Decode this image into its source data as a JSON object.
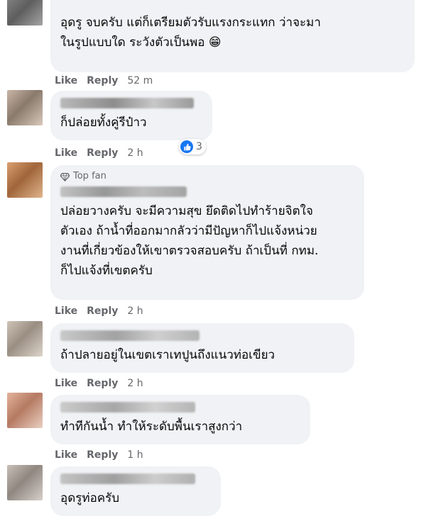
{
  "comments": [
    {
      "text": "อุดรู จบครับ แต่ก็เตรียมตัวรับแรงกระแทก ว่าจะมา\nในรูปแบบใด ระวังตัวเป็นพอ 😁",
      "actions": {
        "like": "Like",
        "reply": "Reply",
        "time": "52 m"
      }
    },
    {
      "text": "ก็ปล่อยทั้งคู่รีป๋าว",
      "actions": {
        "like": "Like",
        "reply": "Reply",
        "time": "2 h"
      },
      "reaction_count": "3"
    },
    {
      "badge": "Top fan",
      "text": "ปล่อยวางครับ จะมีความสุข ยึดติดไปทำร้ายจิตใจ\nตัวเอง ถ้าน้ำที่ออกมากลัวว่ามีปัญหาก็ไปแจ้งหน่วย\nงานที่เกี่ยวข้องให้เขาตรวจสอบครับ ถ้าเป็นที่ กทม.\nก็ไปแจ้งที่เขตครับ",
      "actions": {
        "like": "Like",
        "reply": "Reply",
        "time": "2 h"
      }
    },
    {
      "text": "ถ้าปลายอยู่ในเขตเราเทปูนถึงแนวท่อเขียว",
      "actions": {
        "like": "Like",
        "reply": "Reply",
        "time": "2 h"
      }
    },
    {
      "text": "ทำทีกันน้ำ ทำให้ระดับพื้นเราสูงกว่า",
      "actions": {
        "like": "Like",
        "reply": "Reply",
        "time": "1 h"
      }
    },
    {
      "text": "อุดรูท่อครับ"
    }
  ],
  "colors": {
    "bubble": "#f0f2f5",
    "meta": "#65676b",
    "like_blue": "#1877f2"
  },
  "icons": {
    "top_fan": "diamond-icon",
    "reaction": "thumbs-up-icon"
  }
}
